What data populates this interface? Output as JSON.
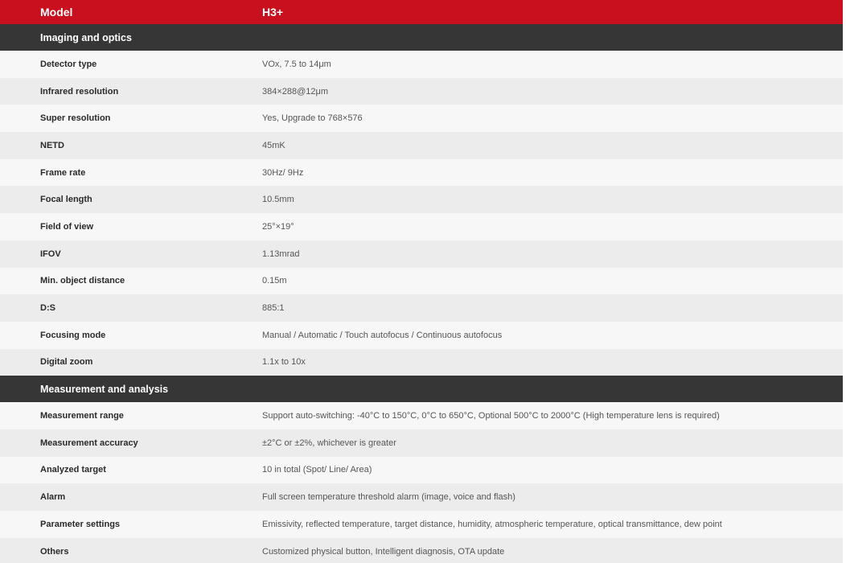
{
  "header": {
    "label": "Model",
    "value": "H3+"
  },
  "sections": [
    {
      "title": "Imaging and optics",
      "rows": [
        {
          "label": "Detector type",
          "value": "VOx, 7.5 to 14μm"
        },
        {
          "label": "Infrared resolution",
          "value": "384×288@12μm"
        },
        {
          "label": "Super resolution",
          "value": "Yes, Upgrade to 768×576"
        },
        {
          "label": "NETD",
          "value": "45mK"
        },
        {
          "label": "Frame rate",
          "value": "30Hz/ 9Hz"
        },
        {
          "label": "Focal length",
          "value": "10.5mm"
        },
        {
          "label": "Field of view",
          "value": "25°×19°"
        },
        {
          "label": "IFOV",
          "value": "1.13mrad"
        },
        {
          "label": "Min. object distance",
          "value": "0.15m"
        },
        {
          "label": "D:S",
          "value": "885:1"
        },
        {
          "label": "Focusing mode",
          "value": "Manual / Automatic / Touch autofocus / Continuous autofocus"
        },
        {
          "label": "Digital zoom",
          "value": "1.1x to 10x"
        }
      ]
    },
    {
      "title": "Measurement and analysis",
      "rows": [
        {
          "label": "Measurement range",
          "value": "Support auto-switching: -40°C to 150°C, 0°C to 650°C, Optional 500°C to 2000°C (High temperature lens is required)"
        },
        {
          "label": "Measurement accuracy",
          "value": "±2°C or ±2%, whichever is greater"
        },
        {
          "label": "Analyzed target",
          "value": "10 in total (Spot/ Line/ Area)"
        },
        {
          "label": "Alarm",
          "value": "Full screen temperature threshold alarm (image, voice and flash)"
        },
        {
          "label": "Parameter settings",
          "value": "Emissivity, reflected temperature, target distance, humidity, atmospheric temperature, optical transmittance, dew point"
        },
        {
          "label": "Others",
          "value": "Customized physical button, Intelligent diagnosis, OTA update"
        }
      ]
    }
  ]
}
